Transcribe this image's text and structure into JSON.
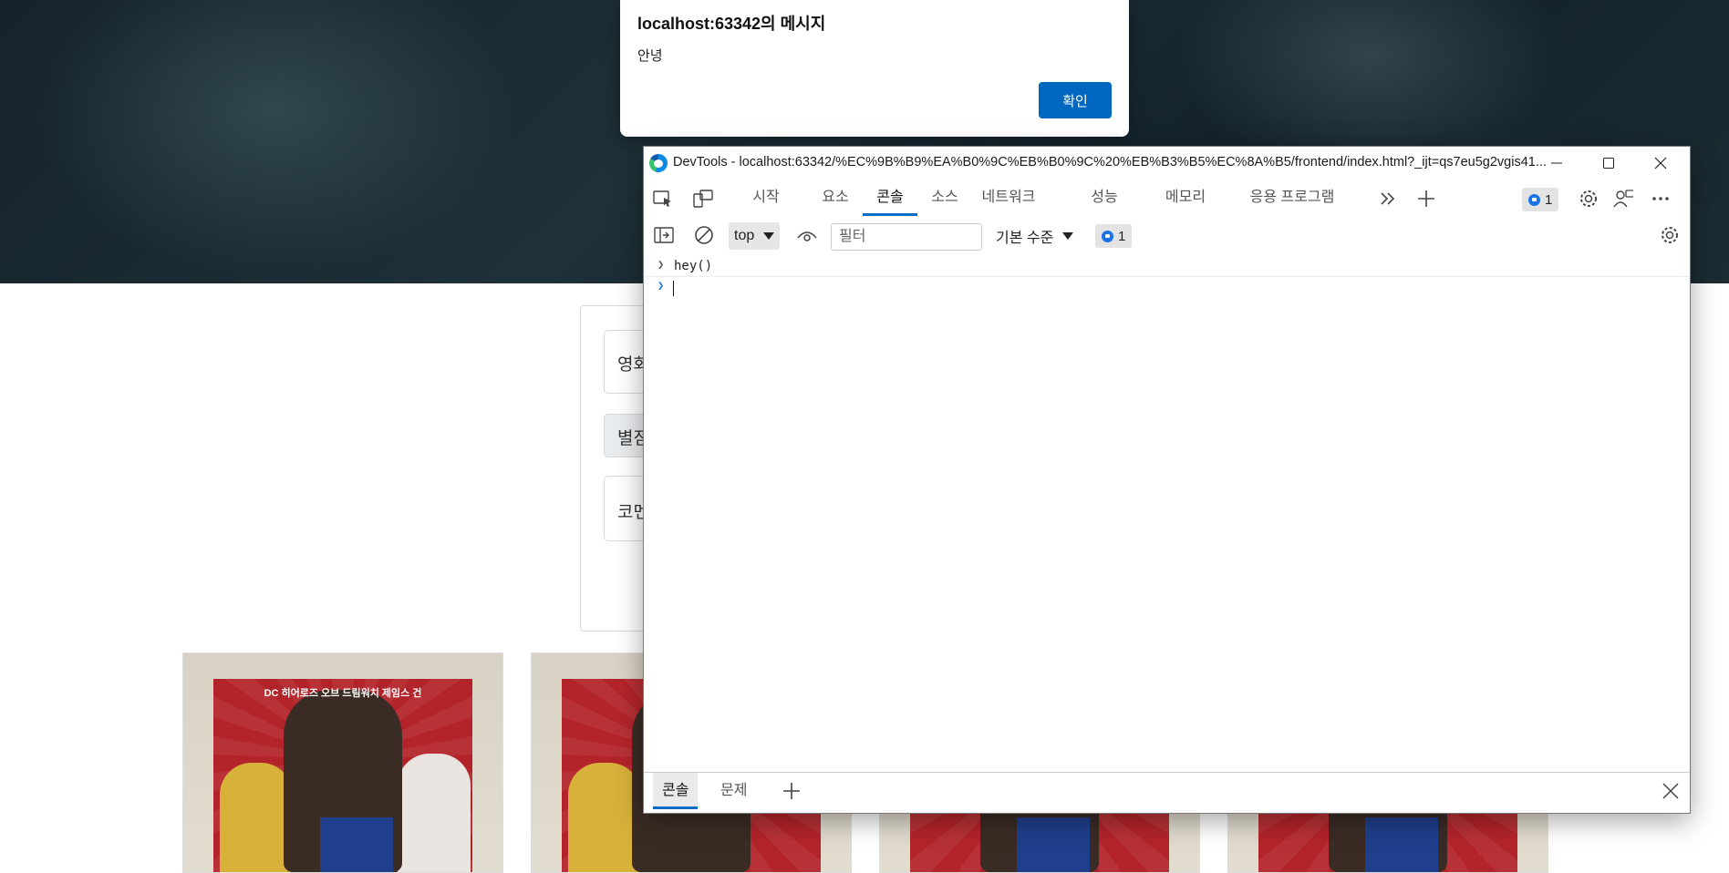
{
  "alert": {
    "title": "localhost:63342의 메시지",
    "message": "안녕",
    "ok_label": "확인"
  },
  "form": {
    "field1_text": "영화",
    "field2_text": "별점",
    "field3_text": "코멘"
  },
  "poster": {
    "caption": "DC 히어로즈 오브 드림워치 제임스 건"
  },
  "devtools": {
    "title": "DevTools - localhost:63342/%EC%9B%B9%EA%B0%9C%EB%B0%9C%20%EB%B3%B5%EC%8A%B5/frontend/index.html?_ijt=qs7eu5g2vgis41...",
    "tabs": [
      "시작",
      "요소",
      "콘솔",
      "소스",
      "네트워크",
      "성능",
      "메모리",
      "응용 프로그램"
    ],
    "active_tab": "콘솔",
    "issues_count": "1",
    "context": "top",
    "filter_placeholder": "필터",
    "level": "기본 수준",
    "messages_count": "1",
    "console_lines": [
      "hey()"
    ],
    "drawer_tabs": [
      "콘솔",
      "문제"
    ],
    "accent": "#0b6cc4"
  }
}
